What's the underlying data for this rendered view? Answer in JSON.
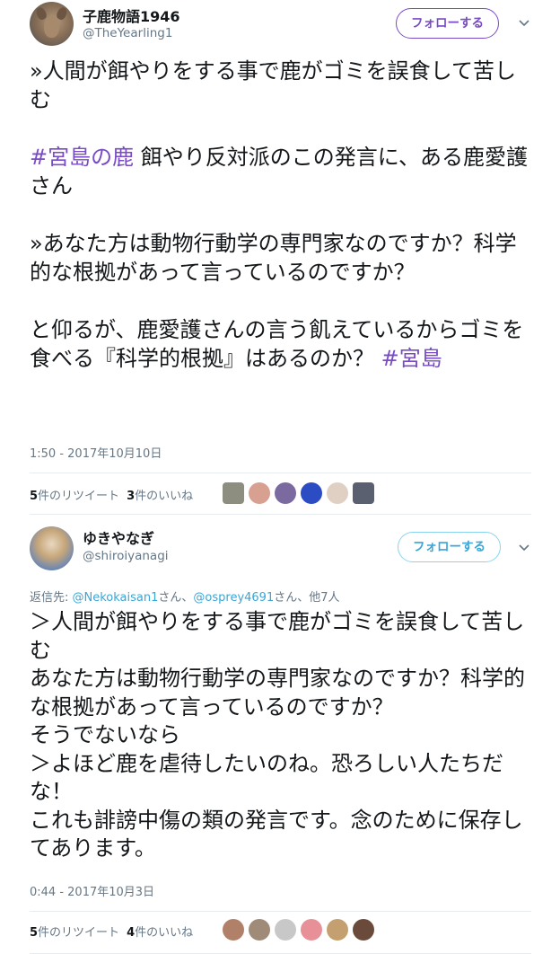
{
  "tweet1": {
    "display_name": "子鹿物語1946",
    "handle": "@TheYearling1",
    "follow_label": "フォローする",
    "body": [
      {
        "text": "»人間が餌やりをする事で鹿がゴミを誤食して苦しむ\n\n",
        "tag": false
      },
      {
        "text": "#宮島の鹿",
        "tag": true
      },
      {
        "text": " 餌やり反対派のこの発言に、ある鹿愛護さん\n\n»あなた方は動物行動学の専門家なのですか？科学的な根拠があって言っているのですか？\n\nと仰るが、鹿愛護さんの言う飢えているからゴミを食べる『科学的根拠』はあるのか？ ",
        "tag": false
      },
      {
        "text": "#宮島",
        "tag": true
      }
    ],
    "timestamp": "1:50 - 2017年10月10日",
    "retweet_count": "5",
    "retweet_label": "件のリツイート",
    "like_count": "3",
    "like_label": "件のいいね",
    "liker_colors": [
      "#8d8d80",
      "#d7a090",
      "#7a6aa0",
      "#2c4cc4",
      "#e0d0c4",
      "#5a6070"
    ]
  },
  "tweet2": {
    "display_name": "ゆきやなぎ",
    "handle": "@shiroiyanagi",
    "follow_label": "フォローする",
    "reply_prefix": "返信先: ",
    "reply_mention1": "@Nekokaisan1",
    "reply_sep1": "さん、",
    "reply_mention2": "@osprey4691",
    "reply_sep2": "さん、他7人",
    "body": "＞人間が餌やりをする事で鹿がゴミを誤食して苦しむ\nあなた方は動物行動学の専門家なのですか？科学的な根拠があって言っているのですか？\nそうでないなら\n＞よほど鹿を虐待したいのね。恐ろしい人たちだな！\nこれも誹謗中傷の類の発言です。念のために保存してあります。",
    "timestamp": "0:44 - 2017年10月3日",
    "retweet_count": "5",
    "retweet_label": "件のリツイート",
    "like_count": "4",
    "like_label": "件のいいね",
    "liker_colors": [
      "#b08068",
      "#a08a78",
      "#c8c8c8",
      "#e89098",
      "#c4a070",
      "#6a4a3a"
    ]
  }
}
